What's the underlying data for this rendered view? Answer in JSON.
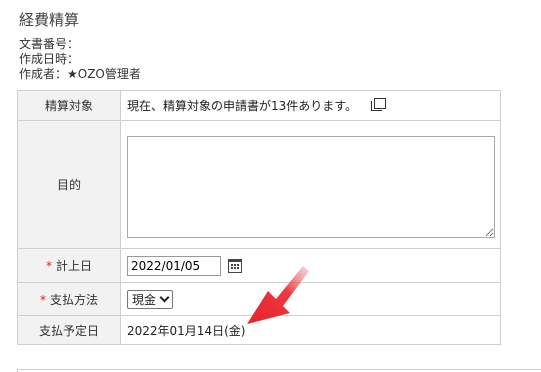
{
  "page_title": "経費精算",
  "meta": {
    "document_number_label": "文書番号：",
    "created_datetime_label": "作成日時：",
    "author_label": "作成者：★OZO管理者"
  },
  "form": {
    "target_label": "精算対象",
    "target_value": "現在、精算対象の申請書が13件あります。",
    "purpose_label": "目的",
    "purpose_value": "",
    "required_mark": "*",
    "posting_date_label": "計上日",
    "posting_date_value": "2022/01/05",
    "payment_method_label": "支払方法",
    "payment_method_value": "現金",
    "scheduled_payment_label": "支払予定日",
    "scheduled_payment_value": "2022年01月14日(金)"
  },
  "colors": {
    "required": "#e02020",
    "arrow": "#e8232a",
    "label_bg": "#f2f2f2",
    "border": "#cfcfcf"
  },
  "icons": [
    "copy-icon",
    "calendar-icon",
    "chevron-down-icon"
  ]
}
